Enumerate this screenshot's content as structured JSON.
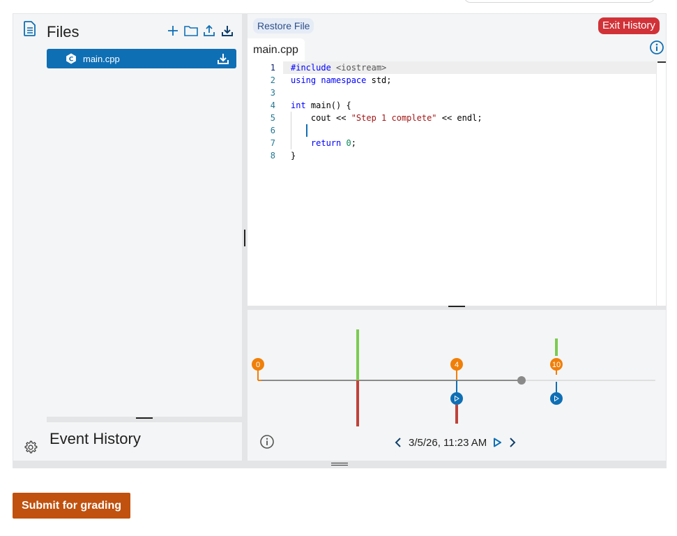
{
  "files_panel": {
    "title": "Files",
    "tools": [
      "add-icon",
      "folder-icon",
      "upload-icon",
      "download-icon"
    ],
    "files": [
      {
        "name": "main.cpp",
        "icon": "cpp-icon",
        "selected": true
      }
    ]
  },
  "event_history": {
    "title": "Event History"
  },
  "editor": {
    "restore_label": "Restore File",
    "exit_label": "Exit History",
    "tab_label": "main.cpp",
    "line_numbers": [
      "1",
      "2",
      "3",
      "4",
      "5",
      "6",
      "7",
      "8"
    ],
    "code": {
      "l1a": "#include",
      "l1b": " <iostream>",
      "l2a": "using",
      "l2b": " namespace",
      "l2c": " std;",
      "l4a": "int",
      "l4b": " main() {",
      "l5a": "    cout << ",
      "l5b": "\"Step 1 complete\"",
      "l5c": " << endl;",
      "l7a": "    return",
      "l7b": " ",
      "l7c": "0",
      "l7d": ";",
      "l8": "}"
    }
  },
  "timeline": {
    "markers": [
      {
        "label": "0",
        "color": "#f07f09"
      },
      {
        "label": "4",
        "color": "#f07f09"
      },
      {
        "label": "10",
        "color": "#f07f09"
      }
    ],
    "date": "3/5/26, 11:23 AM"
  },
  "colors": {
    "accent": "#0f6fb5",
    "orange": "#f07f09",
    "green": "#7ccb52",
    "red": "#c0423a",
    "exit": "#d13238",
    "submit": "#c0510e"
  },
  "submit_label": "Submit for grading"
}
